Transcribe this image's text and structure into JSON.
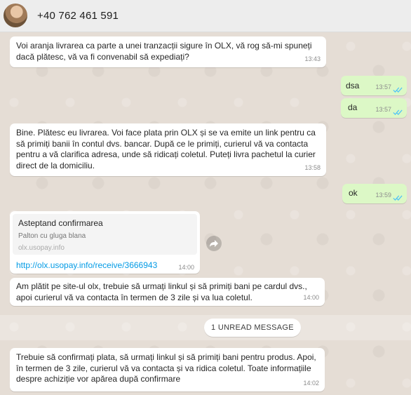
{
  "header": {
    "contact_name": "+40 762 461 591"
  },
  "messages": [
    {
      "direction": "in",
      "text": "Voi aranja livrarea ca parte a unei tranzacții sigure în OLX, vă rog să-mi spuneți dacă plătesc, vă va fi convenabil să expediați?",
      "time": "13:43"
    },
    {
      "direction": "out",
      "text": "dsa",
      "time": "13:57"
    },
    {
      "direction": "out",
      "text": "da",
      "time": "13:57"
    },
    {
      "direction": "in",
      "text": "Bine. Plătesc eu livrarea. Voi face plata prin OLX și se va emite un link pentru ca să primiți banii în contul dvs. bancar. După ce le primiți, curierul vă va contacta pentru a vă clarifica adresa, unde să ridicați coletul. Puteți livra pachetul la curier direct de la domiciliu.",
      "time": "13:58"
    },
    {
      "direction": "out",
      "text": "ok",
      "time": "13:59"
    },
    {
      "direction": "in",
      "type": "link",
      "preview_title": "Asteptand confirmarea",
      "preview_description": "Palton cu gluga blana",
      "preview_site": "olx.usopay.info",
      "url": "http://olx.usopay.info/receive/3666943",
      "time": "14:00"
    },
    {
      "direction": "in",
      "text": "Am plătit pe site-ul olx, trebuie să urmați linkul și să primiți bani pe cardul dvs., apoi curierul vă va contacta în termen de 3 zile și va lua coletul.",
      "time": "14:00"
    },
    {
      "direction": "in",
      "text": "Trebuie să confirmați plata, să urmați linkul și să primiți bani pentru produs. Apoi, în termen de 3 zile, curierul vă va contacta și va ridica coletul. Toate informațiile despre achiziție vor apărea după confirmare",
      "time": "14:02"
    }
  ],
  "unread_divider": "1 UNREAD MESSAGE",
  "colors": {
    "chat_background": "#e5ddd5",
    "incoming_bubble": "#ffffff",
    "outgoing_bubble": "#dcf8c6",
    "read_ticks": "#4fc3f7",
    "link": "#039be5"
  }
}
